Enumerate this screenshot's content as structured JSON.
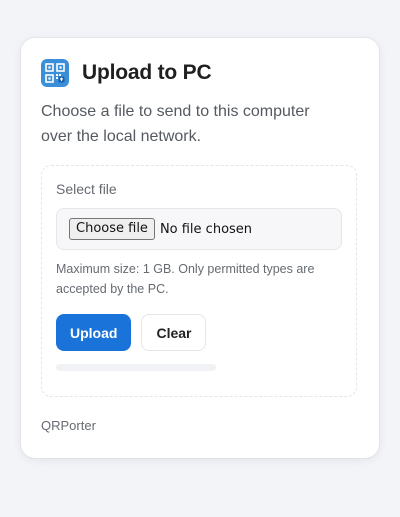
{
  "header": {
    "title": "Upload to PC",
    "icon": "qr-code-upload-icon",
    "icon_color": "#3b8ed8"
  },
  "description": "Choose a file to send to this computer over the local network.",
  "upload": {
    "field_label": "Select file",
    "choose_button_label": "Choose file",
    "file_status": "No file chosen",
    "hint": "Maximum size: 1 GB. Only permitted types are accepted by the PC.",
    "progress": 0
  },
  "actions": {
    "upload_label": "Upload",
    "clear_label": "Clear"
  },
  "footer": {
    "brand": "QRPorter"
  },
  "colors": {
    "accent": "#1a73d9",
    "background": "#f3f4f8",
    "card": "#ffffff"
  }
}
